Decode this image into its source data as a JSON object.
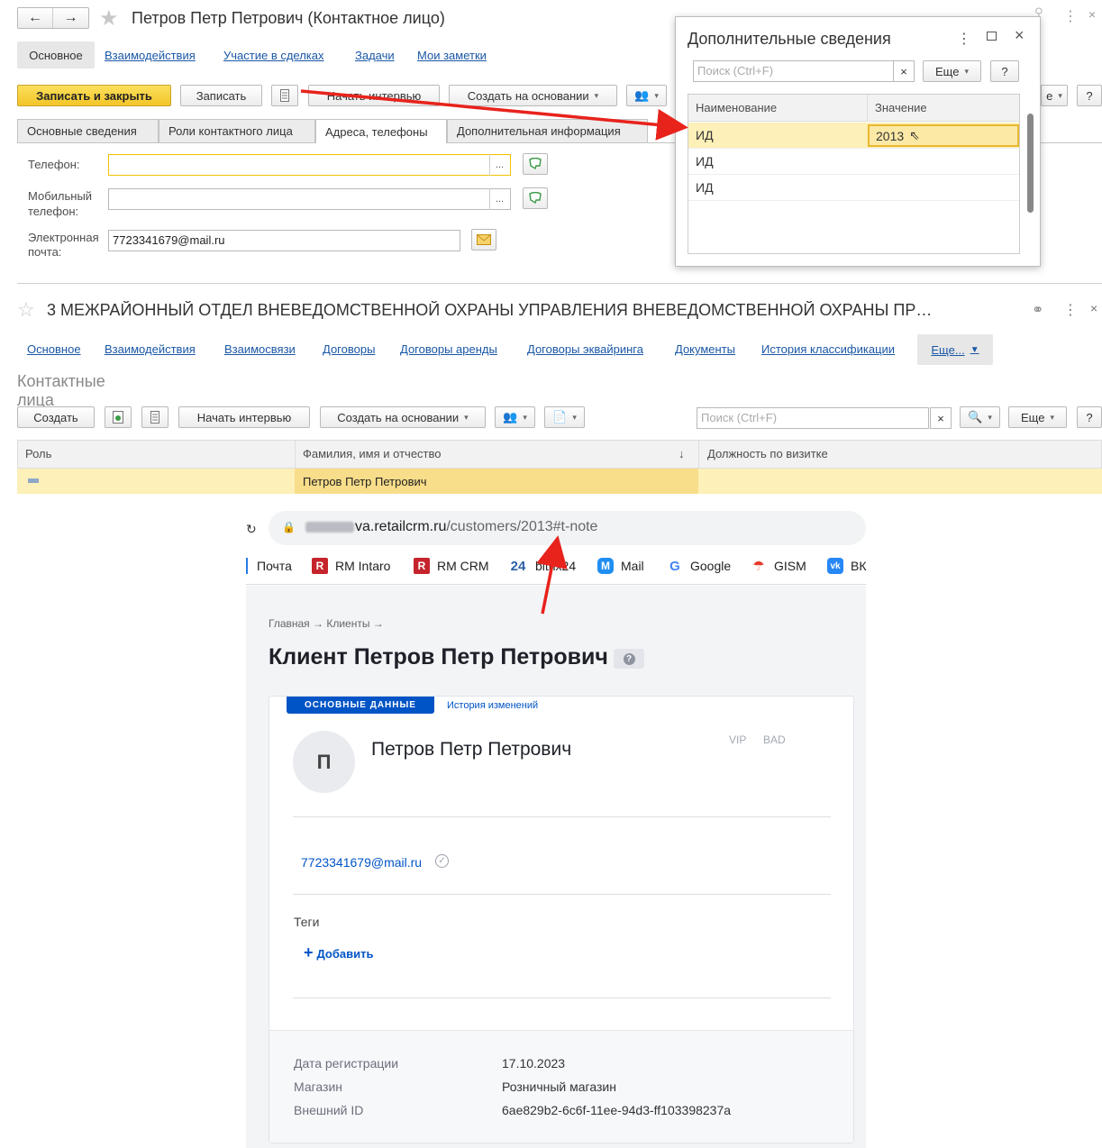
{
  "form1": {
    "title": "Петров Петр Петрович (Контактное лицо)",
    "nav": [
      "Основное",
      "Взаимодействия",
      "Участие в сделках",
      "Задачи",
      "Мои заметки"
    ],
    "toolbar": {
      "save_close": "Записать и закрыть",
      "save": "Записать",
      "start_interview": "Начать интервью",
      "create_based": "Создать на основании",
      "more_partial": "е",
      "help": "?"
    },
    "tabs": [
      "Основные сведения",
      "Роли контактного лица",
      "Адреса, телефоны",
      "Дополнительная информация"
    ],
    "fields": {
      "phone_label": "Телефон:",
      "mobile_label_1": "Мобильный",
      "mobile_label_2": "телефон:",
      "email_label_1": "Электронная",
      "email_label_2": "почта:",
      "email_value": "7723341679@mail.ru",
      "dots": "..."
    }
  },
  "popup": {
    "title": "Дополнительные сведения",
    "search_placeholder": "Поиск (Ctrl+F)",
    "clear": "×",
    "more": "Еще",
    "help": "?",
    "headers": [
      "Наименование",
      "Значение"
    ],
    "rows": [
      {
        "name": "ИД",
        "value": "2013"
      },
      {
        "name": "ИД",
        "value": ""
      },
      {
        "name": "ИД",
        "value": ""
      }
    ]
  },
  "form2": {
    "title": "3 МЕЖРАЙОННЫЙ ОТДЕЛ ВНЕВЕДОМСТВЕННОЙ ОХРАНЫ УПРАВЛЕНИЯ ВНЕВЕДОМСТВЕННОЙ ОХРАНЫ ПР…",
    "nav": [
      "Основное",
      "Взаимодействия",
      "Взаимосвязи",
      "Договоры",
      "Договоры аренды",
      "Договоры эквайринга",
      "Документы",
      "История классификации"
    ],
    "more": "Еще...",
    "section_title": "Контактные лица",
    "toolbar": {
      "create": "Создать",
      "start_interview": "Начать интервью",
      "create_based": "Создать на основании",
      "search_placeholder": "Поиск (Ctrl+F)",
      "clear": "×",
      "more": "Еще",
      "help": "?"
    },
    "headers": [
      "Роль",
      "Фамилия, имя и отчество",
      "Должность по визитке"
    ],
    "sort_arrow": "↓",
    "rows": [
      {
        "role": "",
        "name": "Петров Петр Петрович",
        "position": ""
      }
    ]
  },
  "browser": {
    "url_host": "va.retailcrm.ru",
    "url_path": "/customers/2013#t-note",
    "bookmarks": [
      {
        "label": "Почта",
        "icon": ""
      },
      {
        "label": "RM Intaro",
        "icon": "R"
      },
      {
        "label": "RM CRM",
        "icon": "R"
      },
      {
        "label": "bitrix24",
        "icon": "24"
      },
      {
        "label": "Mail",
        "icon": "M"
      },
      {
        "label": "Google",
        "icon": "G"
      },
      {
        "label": "GISM",
        "icon": ""
      },
      {
        "label": "ВК",
        "icon": "vk"
      }
    ]
  },
  "crm": {
    "breadcrumb": "Главная → Клиенты →",
    "title": "Клиент Петров Петр Петрович",
    "help_icon": "?",
    "tab_main": "ОСНОВНЫЕ ДАННЫЕ",
    "tab_history": "История изменений",
    "avatar_letter": "П",
    "name": "Петров Петр Петрович",
    "badges": [
      "VIP",
      "BAD"
    ],
    "email": "7723341679@mail.ru",
    "tags_label": "Теги",
    "add_label": "Добавить",
    "info": [
      {
        "label": "Дата регистрации",
        "value": "17.10.2023"
      },
      {
        "label": "Магазин",
        "value": "Розничный магазин"
      },
      {
        "label": "Внешний ID",
        "value": "6ae829b2-6c6f-11ee-94d3-ff103398237a"
      }
    ]
  },
  "colors": {
    "primary_yellow": "#f6cf3a",
    "selected_row": "#fdf0b8",
    "link_blue": "#1a57a6",
    "crm_blue": "#0054c6",
    "arrow_red": "#e8231c"
  }
}
